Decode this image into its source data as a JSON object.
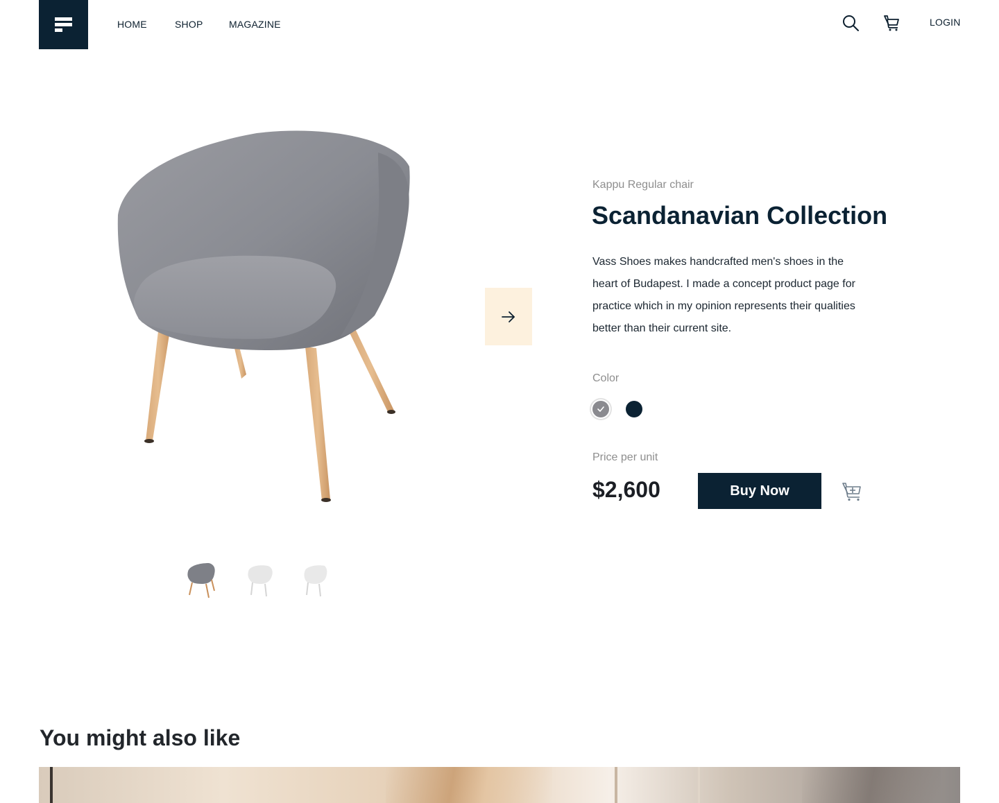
{
  "header": {
    "nav": [
      "HOME",
      "SHOP",
      "MAGAZINE"
    ],
    "login_label": "LOGIN"
  },
  "product": {
    "subtitle": "Kappu Regular chair",
    "title": "Scandanavian Collection",
    "description": "Vass Shoes makes handcrafted men's shoes in the heart of Budapest. I made a concept product page for practice which in my opinion represents their qualities better than their current site.",
    "color_label": "Color",
    "colors": [
      {
        "name": "grey",
        "hex": "#8a8a8f",
        "selected": true
      },
      {
        "name": "navy",
        "hex": "#0b2233",
        "selected": false
      }
    ],
    "price_label": "Price per unit",
    "price": "$2,600",
    "buy_label": "Buy Now"
  },
  "related": {
    "title": "You might also like"
  },
  "colors": {
    "primary": "#0b2233",
    "accent_bg": "#fdf1de",
    "muted": "#8e8e8e"
  }
}
